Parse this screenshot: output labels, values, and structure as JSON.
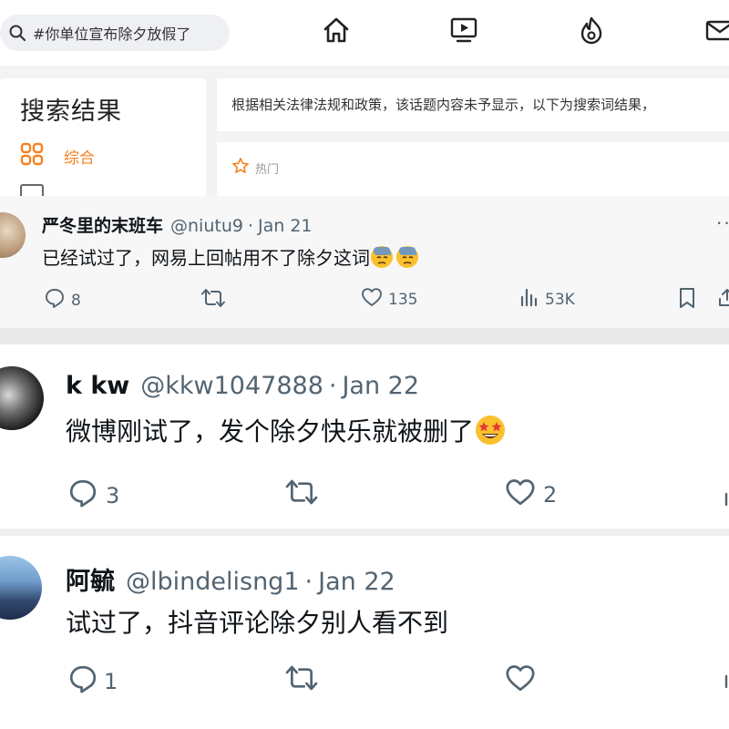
{
  "weibo": {
    "search_query": "#你单位宣布除夕放假了",
    "sidebar_title": "搜索结果",
    "sidebar_item_label": "综合",
    "notice_text": "根据相关法律法规和政策，该话题内容未予显示，以下为搜索词结果，",
    "hot_label": "热门",
    "accent": "#f58220",
    "icons": [
      "search-icon",
      "home-icon",
      "video-icon",
      "fire-icon",
      "mail-icon",
      "grid-icon",
      "star-icon"
    ]
  },
  "tweets": [
    {
      "display_name": "严冬里的末班车",
      "handle": "@niutu9",
      "date": "Jan 21",
      "text": "已经试过了，网易上回帖用不了除夕这词",
      "emoji": "😓😓",
      "replies": "8",
      "likes": "135",
      "views": "53K"
    },
    {
      "display_name": "k kw",
      "handle": "@kkw1047888",
      "date": "Jan 22",
      "text": "微博刚试了，发个除夕快乐就被删了",
      "emoji": "🤩",
      "replies": "3",
      "likes": "2"
    },
    {
      "display_name": "阿毓",
      "handle": "@lbindelisng1",
      "date": "Jan 22",
      "text": "试过了，抖音评论除夕别人看不到",
      "replies": "1"
    }
  ],
  "separator": "·"
}
